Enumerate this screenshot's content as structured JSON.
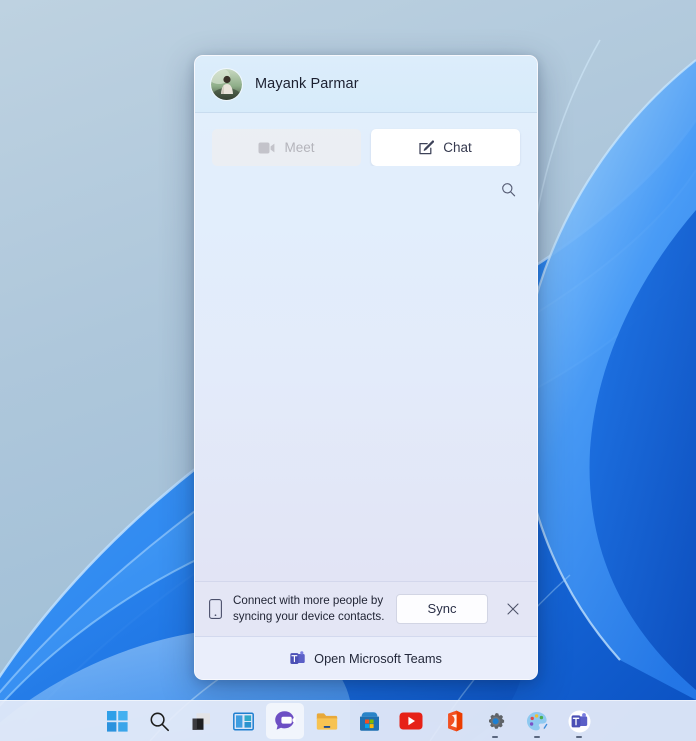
{
  "desktop": {
    "wallpaper_name": "windows-11-bloom-wallpaper",
    "sky_color": "#aec7db",
    "ribbon_color": "#1f7ff0"
  },
  "flyout": {
    "window_name": "Chat flyout",
    "header": {
      "avatar_name": "user-avatar",
      "user_name": "Mayank Parmar"
    },
    "actions": [
      {
        "id": "meet",
        "label": "Meet",
        "icon": "video-camera-icon",
        "disabled": true
      },
      {
        "id": "chat",
        "label": "Chat",
        "icon": "compose-icon",
        "disabled": false
      }
    ],
    "search": {
      "icon": "search-icon",
      "tooltip": "Search"
    },
    "content": {
      "empty": true
    },
    "sync_banner": {
      "icon": "phone-icon",
      "line1": "Connect with more people by",
      "line2": "syncing your device contacts.",
      "sync_label": "Sync",
      "close_icon": "close-icon"
    },
    "footer": {
      "icon": "microsoft-teams-icon",
      "label": "Open Microsoft Teams"
    }
  },
  "taskbar": {
    "items": [
      {
        "id": "start",
        "name": "start-button",
        "icon": "windows-logo-icon",
        "active": false,
        "running": false
      },
      {
        "id": "search",
        "name": "search-button",
        "icon": "search-icon",
        "active": false,
        "running": false
      },
      {
        "id": "taskview",
        "name": "task-view-button",
        "icon": "task-view-icon",
        "active": false,
        "running": false
      },
      {
        "id": "widgets",
        "name": "widgets-button",
        "icon": "widgets-icon",
        "active": false,
        "running": false
      },
      {
        "id": "chat",
        "name": "chat-button",
        "icon": "chat-icon",
        "active": true,
        "running": false
      },
      {
        "id": "explorer",
        "name": "file-explorer-button",
        "icon": "file-explorer-icon",
        "active": false,
        "running": false
      },
      {
        "id": "store",
        "name": "microsoft-store-button",
        "icon": "microsoft-store-icon",
        "active": false,
        "running": false
      },
      {
        "id": "youtube",
        "name": "youtube-button",
        "icon": "youtube-icon",
        "active": false,
        "running": false
      },
      {
        "id": "office",
        "name": "microsoft-office-button",
        "icon": "microsoft-office-icon",
        "active": false,
        "running": false
      },
      {
        "id": "settings",
        "name": "settings-button",
        "icon": "gear-icon",
        "active": false,
        "running": true
      },
      {
        "id": "paint",
        "name": "paint-button",
        "icon": "paint-palette-icon",
        "active": false,
        "running": true
      },
      {
        "id": "teams",
        "name": "microsoft-teams-button",
        "icon": "microsoft-teams-icon",
        "active": false,
        "running": true
      }
    ]
  },
  "colors": {
    "accent": "#0078d4",
    "flyout_header_bg": "#d9ecfa",
    "flyout_body_bg": "#e2eefc",
    "banner_bg": "#e4e6f5",
    "footer_bg": "#eaeefb",
    "taskbar_bg": "#e6ecf9",
    "text_primary": "#1f2333",
    "teams_purple": "#5b5fc7"
  }
}
